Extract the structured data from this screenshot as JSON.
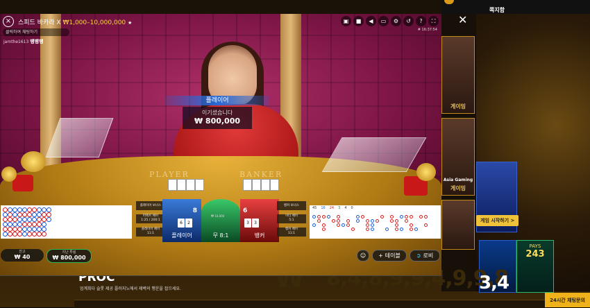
{
  "site": {
    "menu_notice": "쪽지함",
    "card1_label": "게이밍",
    "card2_label": "게이밍",
    "card2_brand": "Asia Gaming",
    "card3_label": "게이밍",
    "start_button": "게임 시작하기 >",
    "jackpot_label": "PAYS",
    "jackpot_value": "243",
    "proc_title": "PROC",
    "proc_desc": "업계최다 슬롯 제공 플러지노에서 제벽의 행운을 잡으세요.",
    "big_number_left": "W",
    "big_number_mid": "8,4,8,9,9,4,9,9,8",
    "big_number_right": "3,4",
    "chat_button": "24시간 채팅문의"
  },
  "game": {
    "title": "스피드 바카라 X",
    "limits": "₩1,000–10,000,000",
    "game_id": "# 16:37:54",
    "chat_placeholder": "클릭하여 채팅하기",
    "chat_user": "jamthe1613",
    "chat_text": "뱅뱅뱅",
    "table_player": "PLAYER",
    "table_banker": "BANKER",
    "win_label": "플레이어",
    "win_msg": "이기셨습니다",
    "win_amount": "₩ 800,000",
    "icons": [
      "chat-icon",
      "video-icon",
      "volume-icon",
      "pip-icon",
      "settings-icon",
      "history-icon",
      "help-icon",
      "fullscreen-icon"
    ]
  },
  "bet": {
    "side_left": [
      {
        "title": "플레이어 보너스",
        "sub": ""
      },
      {
        "title": "퍼펙트 페어",
        "sub": "1:25 / 200:1"
      },
      {
        "title": "플레이어 페어",
        "sub": "11:1"
      }
    ],
    "side_right": [
      {
        "title": "뱅커 보너스",
        "sub": ""
      },
      {
        "title": "이티 페어",
        "sub": "5:1"
      },
      {
        "title": "뱅커 페어",
        "sub": "11:1"
      }
    ],
    "player_score": "8",
    "player_label": "플레이어",
    "player_cards": [
      "6",
      "2"
    ],
    "chip_amount": "800K",
    "tie_label": "무 8:1",
    "tie_amount": "₩ 10,000",
    "banker_score": "6",
    "banker_label": "뱅커",
    "banker_cards": [
      "3",
      "3"
    ],
    "road_stats": [
      "45",
      "16",
      "24",
      "3",
      "4",
      "0"
    ]
  },
  "bottom": {
    "balance_label": "잔고",
    "balance": "₩ 40",
    "total_bet_label": "지난 투링",
    "total_bet": "₩ 800,000",
    "table_btn": "테이블",
    "lobby_btn": "로비"
  }
}
